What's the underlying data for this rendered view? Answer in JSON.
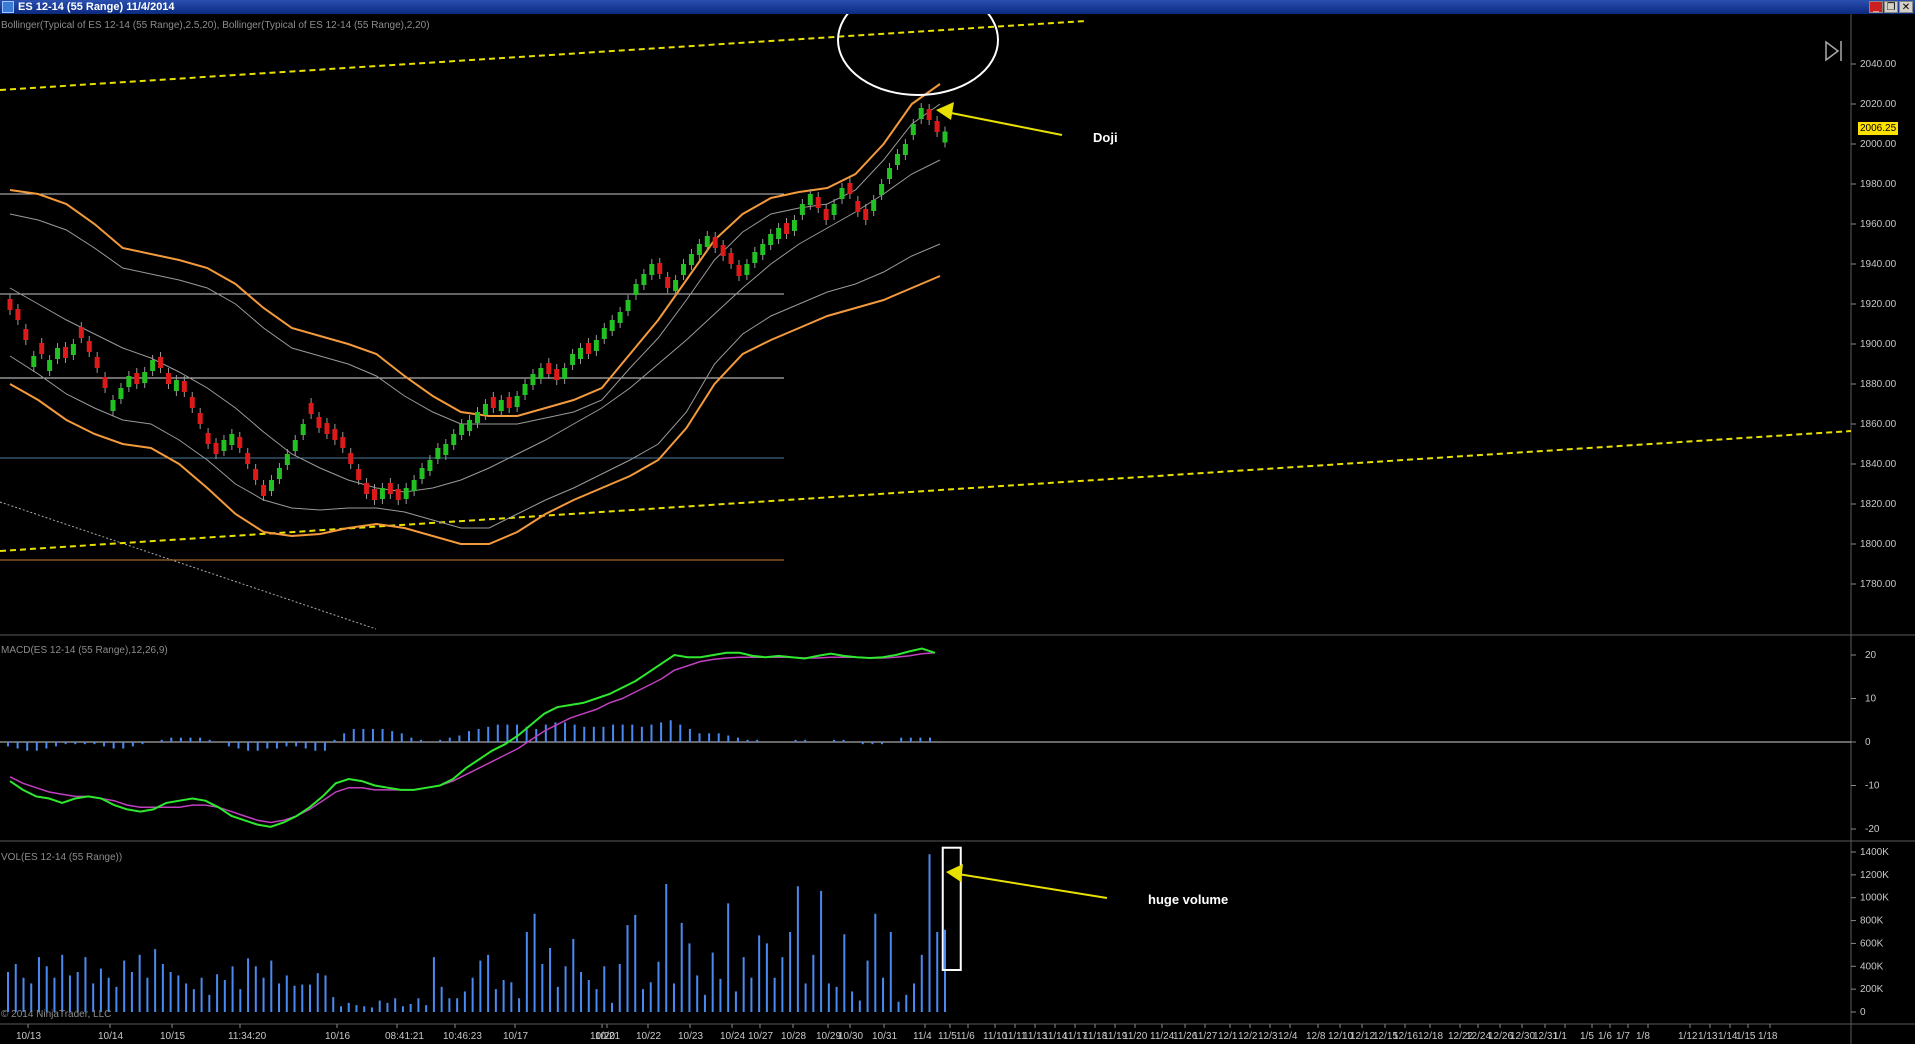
{
  "window": {
    "title": "ES 12-14 (55 Range)  11/4/2014",
    "buttons": [
      "_",
      "❐",
      "✕"
    ],
    "copyright": "© 2014 NinjaTrader, LLC"
  },
  "annotations": {
    "doji": "Doji",
    "huge_volume": "huge volume"
  },
  "colors": {
    "background": "#000000",
    "bull": "#22c022",
    "bear": "#dd1a1a",
    "bollinger_outer": "#f39a3c",
    "bollinger_inner": "#9a9a9a",
    "macd": "#2ee82e",
    "signal": "#c040c0",
    "histogram": "#4a8af0",
    "volume": "#4a8af0",
    "trendline": "#e8e000",
    "price_tag": "#ffe100"
  },
  "chart_data": [
    {
      "type": "candlestick",
      "panel": "price",
      "label": "Bollinger(Typical of ES 12-14 (55 Range),2.5,20), Bollinger(Typical of ES 12-14 (55 Range),2,20)",
      "y_ticks": [
        1780,
        1800,
        1820,
        1840,
        1860,
        1880,
        1900,
        1920,
        1940,
        1960,
        1980,
        2000,
        2020,
        2040
      ],
      "ylim": [
        1770,
        2060
      ],
      "last_price": "2006.25",
      "horizontal_levels": [
        1975,
        1925,
        1883,
        1843,
        1792
      ],
      "x_ticks": [
        "10/13",
        "10/14",
        "10/15",
        "11:34:20",
        "10/16",
        "08:41:21",
        "10:46:23",
        "10/17",
        "10/20",
        "10/21",
        "10/22",
        "10/23",
        "10/24",
        "10/27",
        "10/28",
        "10/29",
        "10/30",
        "10/31",
        "11/4",
        "11/5",
        "11/6",
        "11/10",
        "11/11",
        "11/13",
        "11/14",
        "11/17",
        "11/18",
        "11/19",
        "11/20",
        "11/24",
        "11/26",
        "11/27",
        "12/1",
        "12/2",
        "12/3",
        "12/4",
        "12/8",
        "12/10",
        "12/12",
        "12/15",
        "12/16",
        "12/18",
        "12/22",
        "12/24",
        "12/26",
        "12/30",
        "12/31",
        "1/1",
        "1/5",
        "1/6",
        "1/7",
        "1/8",
        "1/12",
        "1/13",
        "1/14",
        "1/15",
        "1/18"
      ],
      "close": [
        1917,
        1912,
        1902,
        1894,
        1895,
        1892,
        1898,
        1893,
        1900,
        1903,
        1896,
        1888,
        1878,
        1872,
        1878,
        1884,
        1880,
        1886,
        1892,
        1888,
        1880,
        1882,
        1876,
        1868,
        1860,
        1850,
        1845,
        1852,
        1855,
        1848,
        1840,
        1832,
        1824,
        1832,
        1838,
        1845,
        1852,
        1860,
        1865,
        1858,
        1855,
        1852,
        1848,
        1840,
        1832,
        1825,
        1822,
        1828,
        1825,
        1822,
        1828,
        1832,
        1838,
        1842,
        1848,
        1850,
        1855,
        1860,
        1862,
        1866,
        1870,
        1868,
        1872,
        1868,
        1874,
        1880,
        1885,
        1888,
        1885,
        1882,
        1888,
        1895,
        1898,
        1895,
        1902,
        1908,
        1912,
        1916,
        1922,
        1930,
        1935,
        1940,
        1935,
        1928,
        1932,
        1940,
        1945,
        1950,
        1954,
        1948,
        1944,
        1940,
        1934,
        1940,
        1946,
        1950,
        1955,
        1958,
        1955,
        1962,
        1970,
        1975,
        1968,
        1962,
        1970,
        1978,
        1975,
        1966,
        1962,
        1972,
        1980,
        1988,
        1995,
        2000,
        2010,
        2018,
        2012,
        2006,
        2006.25
      ],
      "bull": [
        false,
        false,
        false,
        true,
        false,
        true,
        true,
        false,
        true,
        false,
        false,
        false,
        false,
        true,
        true,
        true,
        false,
        true,
        true,
        false,
        false,
        true,
        false,
        false,
        false,
        false,
        false,
        true,
        true,
        false,
        false,
        false,
        false,
        true,
        true,
        true,
        true,
        true,
        false,
        false,
        false,
        false,
        false,
        false,
        false,
        false,
        false,
        true,
        false,
        false,
        true,
        true,
        true,
        true,
        true,
        true,
        true,
        true,
        true,
        true,
        true,
        false,
        true,
        false,
        true,
        true,
        true,
        true,
        false,
        false,
        true,
        true,
        true,
        false,
        true,
        true,
        true,
        true,
        true,
        true,
        true,
        true,
        false,
        false,
        true,
        true,
        true,
        true,
        true,
        false,
        false,
        false,
        false,
        true,
        true,
        true,
        true,
        true,
        false,
        true,
        true,
        true,
        false,
        false,
        true,
        true,
        false,
        false,
        false,
        true,
        true,
        true,
        true,
        true,
        true,
        true,
        false,
        false,
        true
      ],
      "bb_upper_outer": [
        1977,
        1975,
        1970,
        1960,
        1948,
        1945,
        1942,
        1938,
        1930,
        1918,
        1908,
        1904,
        1900,
        1895,
        1884,
        1874,
        1866,
        1864,
        1864,
        1868,
        1872,
        1878,
        1895,
        1912,
        1932,
        1952,
        1965,
        1973,
        1976,
        1978,
        1985,
        2000,
        2020,
        2030
      ],
      "bb_upper_inner": [
        1965,
        1962,
        1957,
        1948,
        1938,
        1935,
        1932,
        1928,
        1920,
        1908,
        1898,
        1894,
        1890,
        1884,
        1874,
        1866,
        1860,
        1860,
        1860,
        1863,
        1866,
        1872,
        1888,
        1903,
        1922,
        1942,
        1956,
        1965,
        1968,
        1970,
        1977,
        1992,
        2010,
        2020
      ],
      "bb_mid": [
        1928,
        1920,
        1912,
        1905,
        1898,
        1893,
        1886,
        1878,
        1868,
        1856,
        1845,
        1838,
        1832,
        1828,
        1826,
        1828,
        1832,
        1838,
        1845,
        1852,
        1860,
        1868,
        1878,
        1890,
        1902,
        1915,
        1928,
        1940,
        1950,
        1958,
        1966,
        1975,
        1985,
        1992
      ],
      "bb_lower_inner": [
        1894,
        1885,
        1875,
        1868,
        1862,
        1860,
        1852,
        1842,
        1830,
        1822,
        1818,
        1817,
        1818,
        1818,
        1816,
        1812,
        1808,
        1808,
        1815,
        1822,
        1828,
        1835,
        1842,
        1850,
        1866,
        1890,
        1905,
        1914,
        1920,
        1926,
        1930,
        1936,
        1944,
        1950
      ],
      "bb_lower_outer": [
        1880,
        1872,
        1862,
        1855,
        1850,
        1848,
        1840,
        1828,
        1815,
        1806,
        1804,
        1805,
        1808,
        1810,
        1808,
        1804,
        1800,
        1800,
        1806,
        1815,
        1822,
        1828,
        1834,
        1842,
        1858,
        1880,
        1895,
        1902,
        1908,
        1914,
        1918,
        1922,
        1928,
        1934
      ]
    },
    {
      "type": "line",
      "panel": "macd",
      "label": "MACD(ES 12-14 (55 Range),12,26,9)",
      "y_ticks": [
        -20,
        -10,
        0,
        10,
        20
      ],
      "ylim": [
        -22,
        24
      ],
      "macd": [
        -9,
        -11,
        -12.5,
        -13,
        -14,
        -13,
        -12.5,
        -13,
        -14.5,
        -15.5,
        -16,
        -15.5,
        -14,
        -13.5,
        -13,
        -13.5,
        -15,
        -17,
        -18,
        -19,
        -19.5,
        -18.5,
        -17,
        -15,
        -12.5,
        -9.5,
        -8.5,
        -9,
        -10,
        -10.5,
        -11,
        -11,
        -10.5,
        -10,
        -8.5,
        -6,
        -4,
        -2,
        -0.5,
        1.5,
        4,
        6.5,
        8,
        8.5,
        9,
        10,
        11,
        12.5,
        14,
        16,
        18,
        20,
        19.5,
        19.5,
        20,
        20.5,
        20.5,
        19.8,
        19.5,
        19.8,
        19.5,
        19.2,
        19.8,
        20.3,
        19.8,
        19.5,
        19.3,
        19.5,
        20,
        20.8,
        21.5,
        20.5
      ],
      "signal": [
        -8,
        -9.5,
        -10.5,
        -11.5,
        -12,
        -12.5,
        -12.5,
        -13,
        -13.5,
        -14.5,
        -15,
        -15,
        -15,
        -15,
        -14.5,
        -14.5,
        -15,
        -16,
        -17,
        -18,
        -18.5,
        -18,
        -17,
        -15.5,
        -13.5,
        -11.5,
        -10.5,
        -10.5,
        -11,
        -11,
        -11,
        -11,
        -10.5,
        -10,
        -9,
        -7.5,
        -6,
        -4.5,
        -3,
        -1.5,
        0.5,
        2.5,
        4,
        5.5,
        6.5,
        7.5,
        9,
        10,
        11.5,
        13,
        14.5,
        16.5,
        17.5,
        18.5,
        19,
        19.3,
        19.5,
        19.5,
        19.5,
        19.5,
        19.5,
        19.3,
        19.3,
        19.5,
        19.5,
        19.5,
        19.3,
        19.3,
        19.5,
        19.8,
        20.3,
        20.5
      ],
      "histogram": [
        -1,
        -1.5,
        -2,
        -2,
        -1.5,
        -1,
        -0.5,
        -0.5,
        -0.5,
        -0.5,
        -1,
        -1.5,
        -1.5,
        -1,
        -0.5,
        0,
        0.5,
        1,
        1,
        1,
        1,
        0.5,
        0,
        -1,
        -1.5,
        -2,
        -2,
        -1.5,
        -1.5,
        -1,
        -1,
        -1.5,
        -2,
        -2,
        0.5,
        2,
        3,
        3,
        3,
        3,
        2.5,
        2,
        1,
        0.5,
        0,
        0.5,
        1,
        1.5,
        2.5,
        3,
        3.5,
        4,
        4,
        4,
        3.5,
        3,
        4,
        4.5,
        4.5,
        4,
        3.5,
        3.5,
        3.5,
        4,
        4,
        4,
        3.5,
        4,
        4.5,
        5,
        4,
        3,
        2,
        2,
        2,
        1.5,
        1,
        0.5,
        0.5,
        0,
        0,
        0,
        0.5,
        0.5,
        0,
        0,
        0.5,
        0.5,
        0,
        -0.5,
        -0.5,
        -0.5,
        0,
        1,
        1,
        1,
        1
      ]
    },
    {
      "type": "bar",
      "panel": "volume",
      "label": "VOL(ES 12-14 (55 Range))",
      "y_ticks": [
        "0",
        "200K",
        "400K",
        "600K",
        "800K",
        "1000K",
        "1200K",
        "1400K"
      ],
      "ylim": [
        0,
        1450000
      ],
      "values": [
        350000,
        420000,
        300000,
        250000,
        480000,
        400000,
        300000,
        500000,
        320000,
        350000,
        480000,
        250000,
        380000,
        300000,
        220000,
        450000,
        350000,
        500000,
        300000,
        550000,
        420000,
        350000,
        320000,
        250000,
        200000,
        300000,
        150000,
        330000,
        280000,
        400000,
        200000,
        470000,
        400000,
        300000,
        450000,
        250000,
        320000,
        230000,
        240000,
        240000,
        340000,
        320000,
        130000,
        50000,
        80000,
        60000,
        50000,
        40000,
        100000,
        80000,
        120000,
        50000,
        70000,
        120000,
        60000,
        480000,
        220000,
        120000,
        120000,
        180000,
        300000,
        450000,
        500000,
        200000,
        280000,
        260000,
        120000,
        700000,
        860000,
        420000,
        560000,
        220000,
        400000,
        640000,
        350000,
        280000,
        200000,
        400000,
        80000,
        420000,
        760000,
        850000,
        200000,
        260000,
        440000,
        1120000,
        250000,
        780000,
        600000,
        320000,
        150000,
        520000,
        290000,
        950000,
        180000,
        480000,
        300000,
        670000,
        600000,
        300000,
        480000,
        700000,
        1100000,
        250000,
        500000,
        1060000,
        250000,
        220000,
        680000,
        180000,
        100000,
        450000,
        860000,
        300000,
        700000,
        90000,
        150000,
        250000,
        500000,
        1380000,
        700000,
        720000
      ],
      "highlight_index": 122
    }
  ]
}
